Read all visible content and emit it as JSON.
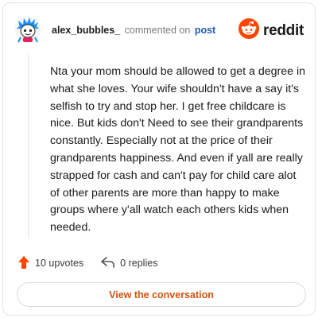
{
  "comment": {
    "username": "alex_bubbles_",
    "action_text": "commented on",
    "post_link": "post",
    "body": "Nta your mom should be allowed to get a degree in what she loves. Your wife shouldn't have a say it's selfish to try and stop her. I get free childcare is nice. But kids don't Need to see their grandparents constantly. Especially not at the price of their grandparents happiness. And even if yall are really strapped for cash and can't pay for child care alot of other parents are more than happy to make groups where y'all watch each others kids when needed."
  },
  "brand": {
    "name": "reddit",
    "color": "#ff4500"
  },
  "stats": {
    "upvotes": "10 upvotes",
    "replies": "0 replies"
  },
  "cta": {
    "label": "View the conversation",
    "color": "#d4510f"
  },
  "icons": {
    "avatar": "snoo-avatar-blue-hair",
    "brand": "reddit-snoo-icon",
    "upvote": "upvote-arrow-icon",
    "reply": "reply-arrow-icon"
  }
}
